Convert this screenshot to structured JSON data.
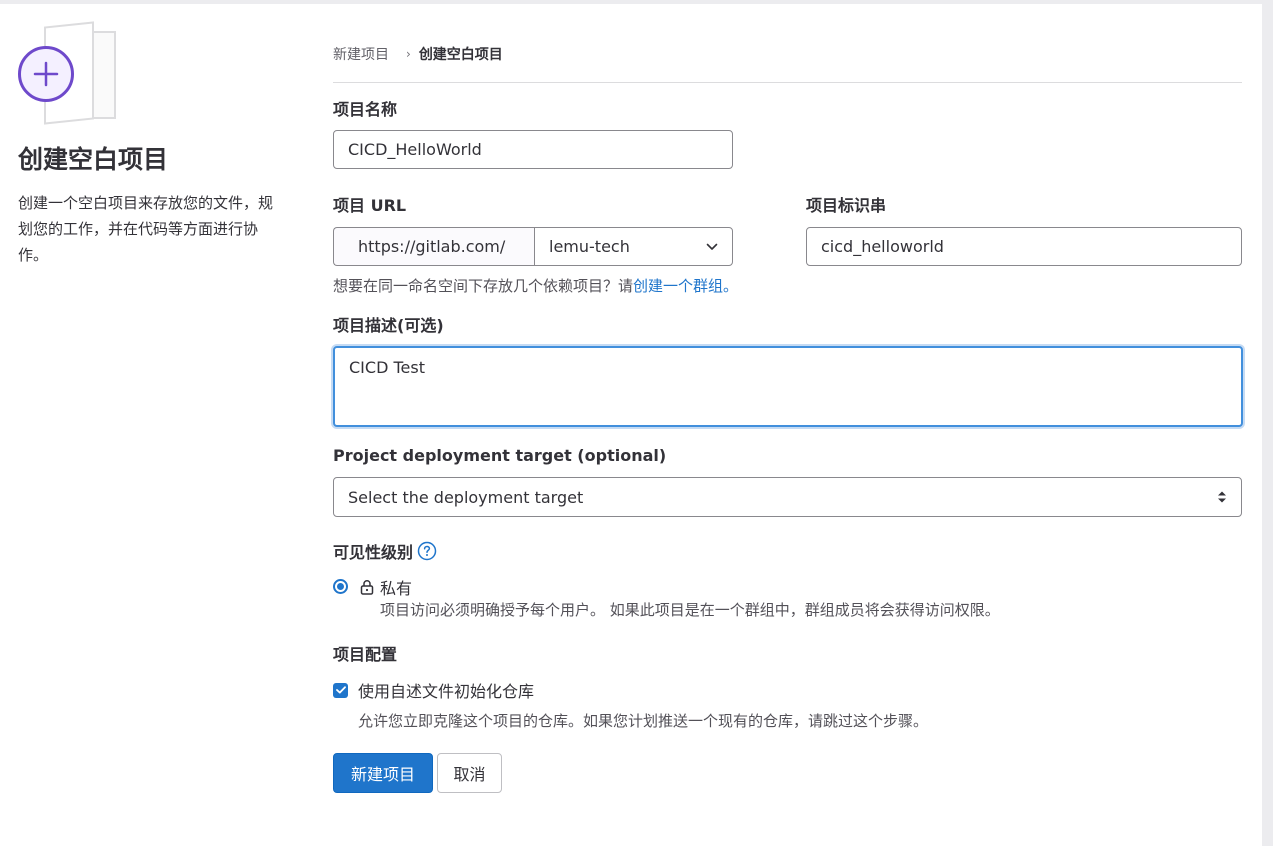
{
  "left": {
    "title": "创建空白项目",
    "description": "创建一个空白项目来存放您的文件，规划您的工作，并在代码等方面进行协作。"
  },
  "breadcrumb": {
    "parent": "新建项目",
    "separator": "›",
    "current": "创建空白项目"
  },
  "form": {
    "name_label": "项目名称",
    "name_value": "CICD_HelloWorld",
    "url_label": "项目 URL",
    "url_prefix": "https://gitlab.com/",
    "namespace_value": "lemu-tech",
    "slug_label": "项目标识串",
    "slug_value": "cicd_helloworld",
    "hint_text": "想要在同一命名空间下存放几个依赖项目？请",
    "hint_link": "创建一个群组。",
    "description_label": "项目描述(可选)",
    "description_value": "CICD Test",
    "deploy_label": "Project deployment target (optional)",
    "deploy_placeholder": "Select the deployment target",
    "visibility_label": "可见性级别",
    "visibility_option": "私有",
    "visibility_desc": "项目访问必须明确授予每个用户。 如果此项目是在一个群组中，群组成员将会获得访问权限。",
    "config_label": "项目配置",
    "readme_label": "使用自述文件初始化仓库",
    "readme_desc": "允许您立即克隆这个项目的仓库。如果您计划推送一个现有的仓库，请跳过这个步骤。",
    "create_button": "新建项目",
    "cancel_button": "取消"
  },
  "colors": {
    "primary": "#1f75cb",
    "illustration": "#6e49cb"
  },
  "icons": {
    "illustration": "plus-circle-illustration",
    "namespace_dropdown": "chevron-down-icon",
    "deploy_dropdown": "sort-arrows-icon",
    "visibility_help": "question-circle-icon",
    "private": "lock-icon",
    "checkbox": "check-icon"
  }
}
